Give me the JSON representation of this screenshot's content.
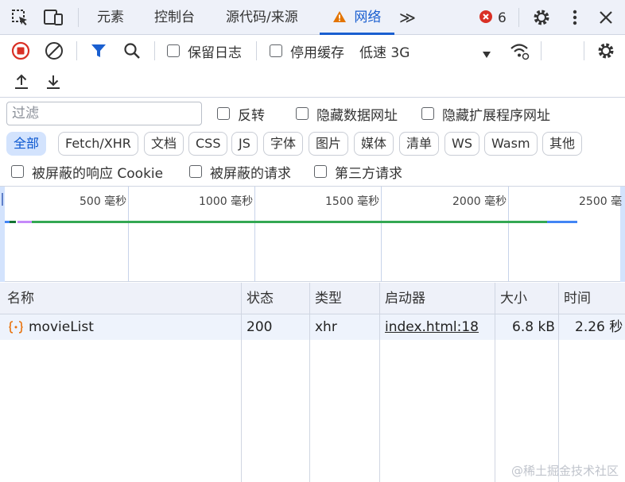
{
  "tabs": {
    "elements": "元素",
    "console": "控制台",
    "sources": "源代码/来源",
    "network": "网络",
    "more": "≫",
    "error_count": "6"
  },
  "toolbar": {
    "preserve_log": "保留日志",
    "disable_cache": "停用缓存",
    "throttle": "低速 3G"
  },
  "filter": {
    "placeholder": "过滤",
    "invert": "反转",
    "hide_data_urls": "隐藏数据网址",
    "hide_extension_urls": "隐藏扩展程序网址"
  },
  "types": [
    "全部",
    "Fetch/XHR",
    "文档",
    "CSS",
    "JS",
    "字体",
    "图片",
    "媒体",
    "清单",
    "WS",
    "Wasm",
    "其他"
  ],
  "blocked": {
    "blocked_cookies": "被屏蔽的响应 Cookie",
    "blocked_requests": "被屏蔽的请求",
    "third_party": "第三方请求"
  },
  "overview": {
    "ticks": [
      "500 毫秒",
      "1000 毫秒",
      "1500 毫秒",
      "2000 毫秒",
      "2500 毫"
    ]
  },
  "table": {
    "headers": [
      "名称",
      "状态",
      "类型",
      "启动器",
      "大小",
      "时间"
    ],
    "rows": [
      {
        "name": "movieList",
        "status": "200",
        "type": "xhr",
        "initiator": "index.html:18",
        "size": "6.8 kB",
        "time": "2.26 秒"
      }
    ]
  },
  "watermark": "@稀土掘金技术社区",
  "colors": {
    "accent": "#1a5fd0",
    "record": "#d93025",
    "error": "#d93025",
    "warning": "#e37400",
    "bar_green": "#34a853",
    "bar_blue": "#4285f4",
    "bar_purple": "#c58af9"
  }
}
